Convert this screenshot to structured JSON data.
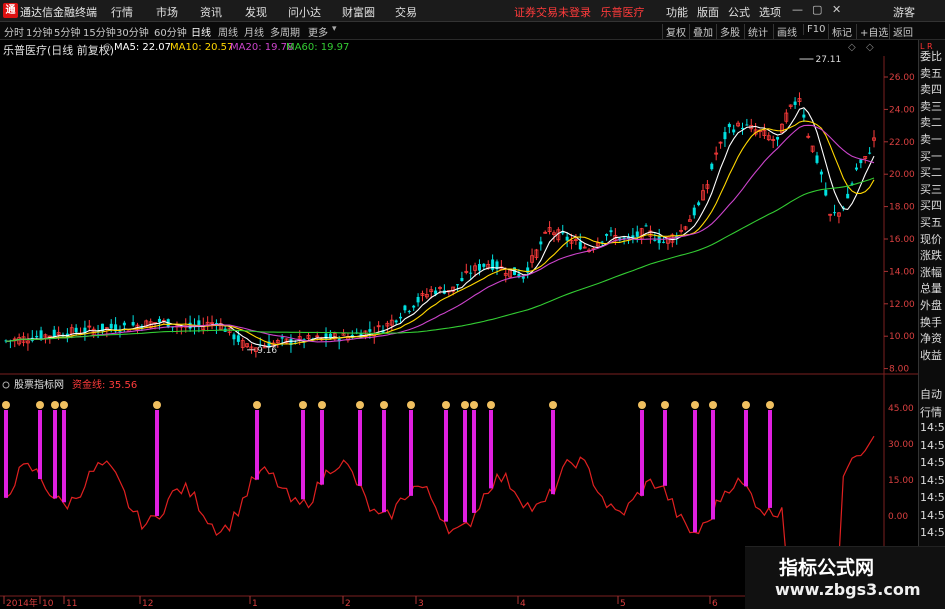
{
  "menubar": {
    "app_title": "通达信金融终端",
    "items": [
      "行情",
      "市场",
      "资讯",
      "发现",
      "问小达",
      "财富圈",
      "交易"
    ],
    "status_notice": "证券交易未登录",
    "stock_name": "乐普医疗",
    "right_items": [
      "功能",
      "版面",
      "公式",
      "选项"
    ],
    "guest": "游客"
  },
  "toolbar": {
    "periods": [
      "分时",
      "1分钟",
      "5分钟",
      "15分钟",
      "30分钟",
      "60分钟",
      "日线",
      "周线",
      "月线",
      "多周期",
      "更多"
    ],
    "active_period": "日线",
    "right_buttons": [
      "复权",
      "叠加",
      "多股",
      "统计",
      "画线",
      "F10",
      "标记",
      "+自选",
      "返回"
    ]
  },
  "main_chart": {
    "title": "乐普医疗(日线 前复权)",
    "ma": [
      {
        "label": "MA5: 22.07",
        "color": "#ffffff"
      },
      {
        "label": "MA10: 20.57",
        "color": "#ffd700"
      },
      {
        "label": "MA20: 19.78",
        "color": "#cc44cc"
      },
      {
        "label": "MA60: 19.97",
        "color": "#33cc33"
      }
    ],
    "y_ticks": [
      "26.00",
      "24.00",
      "22.00",
      "20.00",
      "18.00",
      "16.00",
      "14.00",
      "12.00",
      "10.00",
      "8.00"
    ],
    "high_label": "27.11",
    "low_label": "9.16"
  },
  "indicator": {
    "title": "股票指标网",
    "line_label": "资金线: 35.56",
    "y_ticks": [
      "45.00",
      "30.00",
      "15.00",
      "0.00"
    ]
  },
  "x_axis": [
    "2014年",
    "10",
    "11",
    "12",
    "1",
    "2",
    "3",
    "4",
    "5",
    "6"
  ],
  "side_panel": [
    "委比",
    "卖五",
    "卖四",
    "卖三",
    "卖二",
    "卖一",
    "买一",
    "买二",
    "买三",
    "买四",
    "买五",
    "现价",
    "涨跌",
    "涨幅",
    "总量",
    "外盘",
    "换手",
    "净资",
    "收益"
  ],
  "side_panel_lower": [
    "自动",
    "行情",
    "14:5",
    "14:5",
    "14:5",
    "14:5",
    "14:5",
    "14:5",
    "14:5",
    "14:5"
  ],
  "corner_label": "L R",
  "watermark": {
    "title": "指标公式网",
    "url": "www.zbgs3.com"
  }
}
